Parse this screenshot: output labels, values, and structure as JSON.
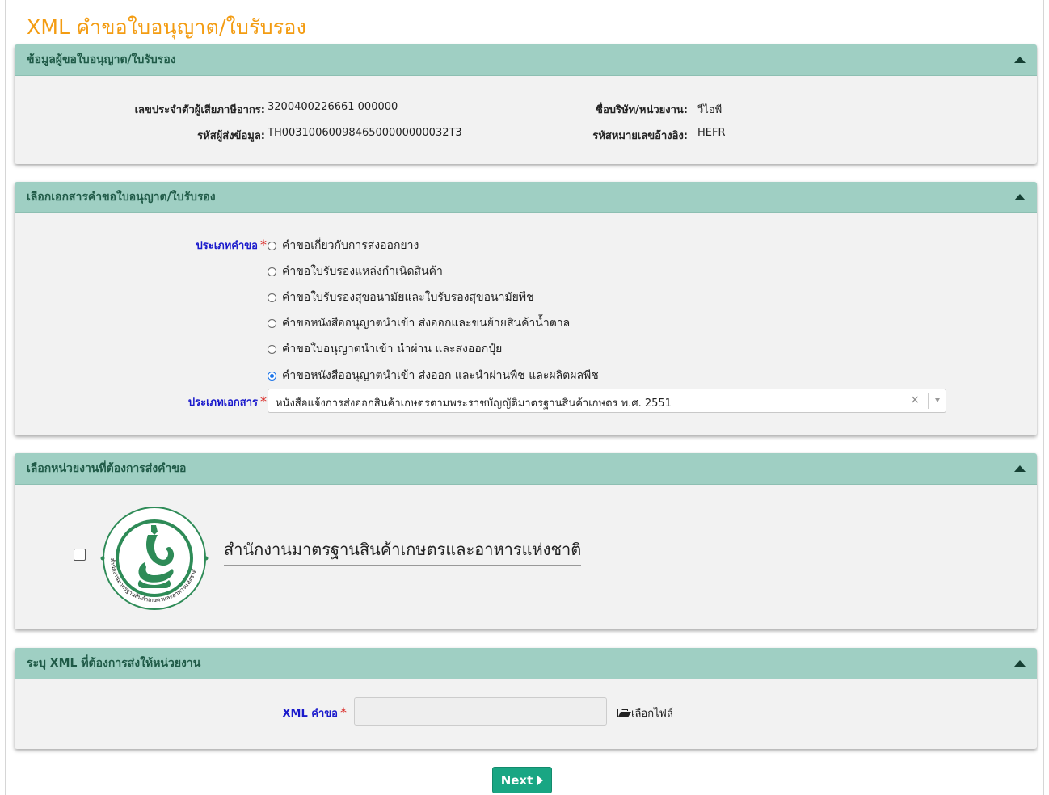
{
  "page": {
    "title": "XML คำขอใบอนุญาต/ใบรับรอง"
  },
  "applicant_panel": {
    "title": "ข้อมูลผู้ขอใบอนุญาต/ใบรับรอง",
    "tax_id_label": "เลขประจำตัวผู้เสียภาษีอากร:",
    "tax_id_value": "3200400226661 000000",
    "company_label": "ชื่อบริษัท/หน่วยงาน:",
    "company_value": "วีไอพี",
    "sender_code_label": "รหัสผู้ส่งข้อมูล:",
    "sender_code_value": "TH0031006009846500000000032T3",
    "reference_label": "รหัสหมายเลขอ้างอิง:",
    "reference_value": "HEFR"
  },
  "document_panel": {
    "title": "เลือกเอกสารคำขอใบอนุญาต/ใบรับรอง",
    "request_type_label": "ประเภทคำขอ",
    "request_types": [
      {
        "label": "คำขอเกี่ยวกับการส่งออกยาง",
        "selected": false
      },
      {
        "label": "คำขอใบรับรองแหล่งกำเนิดสินค้า",
        "selected": false
      },
      {
        "label": "คำขอใบรับรองสุขอนามัยและใบรับรองสุขอนามัยพืช",
        "selected": false
      },
      {
        "label": "คำขอหนังสืออนุญาตนำเข้า ส่งออกและขนย้ายสินค้าน้ำตาล",
        "selected": false
      },
      {
        "label": "คำขอใบอนุญาตนำเข้า นำผ่าน และส่งออกปุ๋ย",
        "selected": false
      },
      {
        "label": "คำขอหนังสืออนุญาตนำเข้า ส่งออก และนำผ่านพืช และผลิตผลพืช",
        "selected": true
      }
    ],
    "document_type_label": "ประเภทเอกสาร",
    "document_type_value": "หนังสือแจ้งการส่งออกสินค้าเกษตรตามพระราชบัญญัติมาตรฐานสินค้าเกษตร พ.ศ. 2551",
    "clear_symbol": "×",
    "required_mark": "*"
  },
  "agency_panel": {
    "title": "เลือกหน่วยงานที่ต้องการส่งคำขอ",
    "agency_name": "สำนักงานมาตรฐานสินค้าเกษตรและอาหารแห่งชาติ",
    "logo_ring_text": "สำนักงานมาตรฐานสินค้าเกษตรและอาหารแห่งชาติ",
    "checked": false
  },
  "xml_panel": {
    "title": "ระบุ XML ที่ต้องการส่งให้หน่วยงาน",
    "xml_label": "XML คำขอ",
    "choose_file_label": "เลือกไฟล์",
    "file_value": ""
  },
  "actions": {
    "next_label": "Next"
  },
  "colors": {
    "title_orange": "#f39c12",
    "panel_header": "#9fcfc3",
    "panel_title_text": "#1f5a47",
    "panel_body": "#f2f2f2",
    "required_red": "#d9231f",
    "label_blue": "#1a1acc",
    "radio_selected": "#1a73e8",
    "next_button": "#19a683",
    "logo_green": "#2e8b57"
  },
  "icons": {
    "collapse": "caret-up-icon",
    "folder": "folder-open-icon",
    "next": "caret-right-icon"
  }
}
